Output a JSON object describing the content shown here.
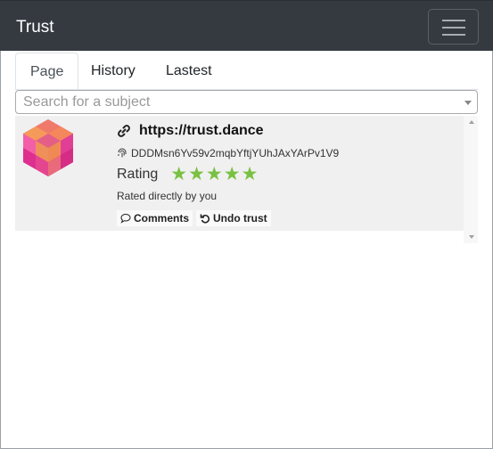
{
  "navbar": {
    "brand": "Trust"
  },
  "tabs": [
    {
      "label": "Page",
      "active": true
    },
    {
      "label": "History",
      "active": false
    },
    {
      "label": "Lastest",
      "active": false
    }
  ],
  "search": {
    "placeholder": "Search for a subject"
  },
  "results": [
    {
      "title": "https://trust.dance",
      "id": "DDDMsn6Yv59v2mqbYftjYUhJAxYArPv1V9",
      "rating_label": "Rating",
      "rating": 5,
      "stars": [
        "★",
        "★",
        "★",
        "★",
        "★"
      ],
      "status": "Rated directly by you",
      "actions": {
        "comments": "Comments",
        "undo": "Undo trust"
      }
    }
  ],
  "colors": {
    "navbar": "#343a40",
    "star": "#7ac143",
    "item_bg": "#f0f0f0"
  }
}
